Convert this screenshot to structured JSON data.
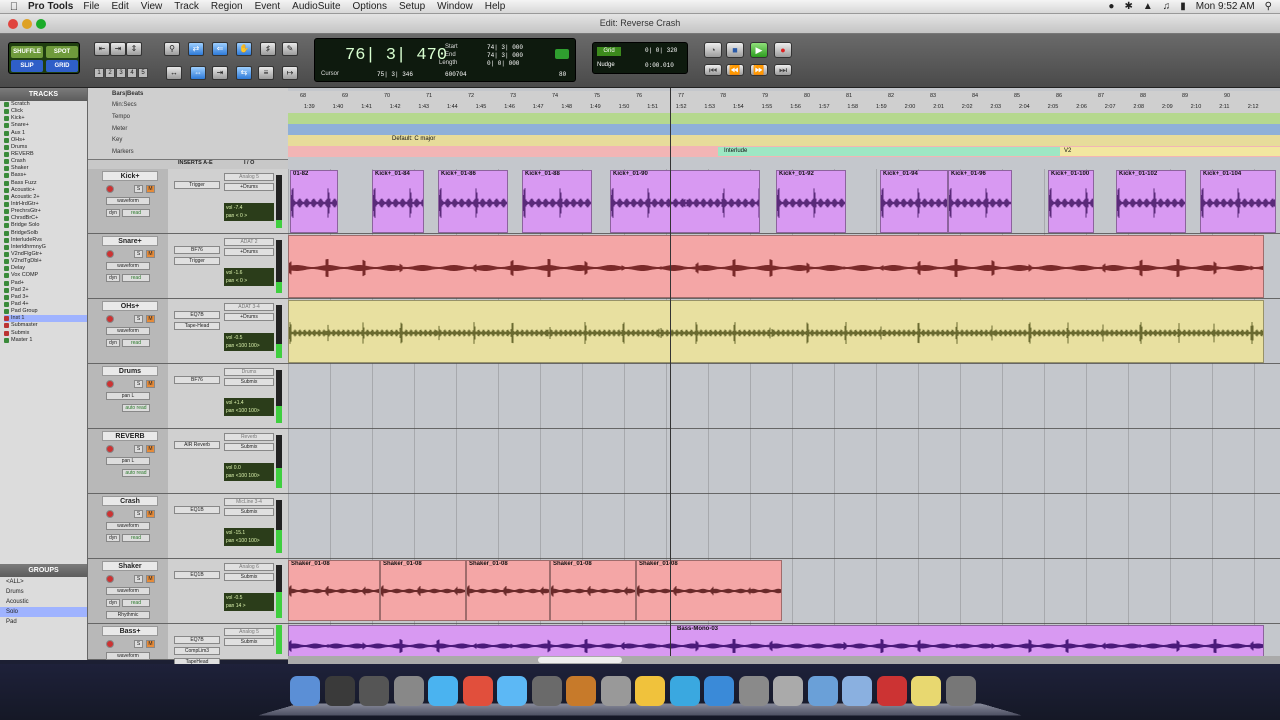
{
  "menubar": {
    "app": "Pro Tools",
    "items": [
      "File",
      "Edit",
      "View",
      "Track",
      "Region",
      "Event",
      "AudioSuite",
      "Options",
      "Setup",
      "Window",
      "Help"
    ],
    "clock": "Mon 9:52 AM"
  },
  "window": {
    "title": "Edit: Reverse Crash"
  },
  "toolbar": {
    "modes": [
      "SHUFFLE",
      "SPOT",
      "SLIP",
      "GRID"
    ],
    "zoom_presets": [
      "1",
      "2",
      "3",
      "4",
      "5"
    ],
    "main_counter": "76| 3| 470",
    "start_label": "Start",
    "end_label": "End",
    "length_label": "Length",
    "start": "74| 3| 000",
    "end": "74| 3| 000",
    "length": "0| 0| 000",
    "cursor_label": "Cursor",
    "cursor": "75| 3| 346",
    "sample": "600704",
    "tempo": "80",
    "grid_label": "Grid",
    "grid_value": "0| 0| 320",
    "nudge_label": "Nudge",
    "nudge_value": "0:00.010"
  },
  "tracks_panel": {
    "title": "TRACKS",
    "items": [
      "Scratch",
      "Click",
      "Kick+",
      "Snare+",
      "Aux 1",
      "OHs+",
      "Drums",
      "REVERB",
      "Crash",
      "Shaker",
      "Bass+",
      "Bass Fuzz",
      "Acoustic+",
      "Acoustic 2+",
      "IntrHrdGtr+",
      "PrechrsGtr+",
      "ChrsdBrC+",
      "Bridge Solo",
      "BridgeSolb",
      "InterludeRvs",
      "InterldhrmnyG",
      "V2ndFlgGtr+",
      "V2ndTgDbl+",
      "Delay",
      "Vox COMP",
      "Pad+",
      "Pad 2+",
      "Pad 3+",
      "Pad 4+",
      "Pad Group",
      "Inst 1",
      "Submaster",
      "Submix",
      "Master 1"
    ]
  },
  "groups_panel": {
    "title": "GROUPS",
    "items": [
      "<ALL>",
      "Drums",
      "Acoustic",
      "Solo",
      "Pad"
    ]
  },
  "ruler": {
    "labels": [
      "Bars|Beats",
      "Min:Secs",
      "Tempo",
      "Meter",
      "Key",
      "Markers"
    ],
    "bars": [
      "68",
      "69",
      "70",
      "71",
      "72",
      "73",
      "74",
      "75",
      "76",
      "77",
      "78",
      "79",
      "80",
      "81",
      "82",
      "83",
      "84",
      "85",
      "86",
      "87",
      "88",
      "89",
      "90"
    ],
    "times": [
      "1:39",
      "1:40",
      "1:41",
      "1:42",
      "1:43",
      "1:44",
      "1:45",
      "1:46",
      "1:47",
      "1:48",
      "1:49",
      "1:50",
      "1:51",
      "1:52",
      "1:53",
      "1:54",
      "1:55",
      "1:56",
      "1:57",
      "1:58",
      "1:59",
      "2:00",
      "2:01",
      "2:02",
      "2:03",
      "2:04",
      "2:05",
      "2:06",
      "2:07",
      "2:08",
      "2:09",
      "2:10",
      "2:11",
      "2:12"
    ],
    "key_text": "Default: C major",
    "marker_interlude": "Interlude",
    "marker_v2": "V2"
  },
  "header_cols": {
    "inserts": "INSERTS A-E",
    "io": "I / O"
  },
  "tracks": [
    {
      "name": "Kick+",
      "insert1": "Trigger",
      "io_in": "Analog 5",
      "io_out": "+Drums",
      "view": "waveform",
      "dyn": "dyn",
      "mode": "read",
      "vol": "-7.4",
      "pan": "< 0 >",
      "color": "#d899f2"
    },
    {
      "name": "Snare+",
      "insert1": "BF76",
      "insert2": "Trigger",
      "io_in": "ADAT 2",
      "io_out": "+Drums",
      "view": "waveform",
      "dyn": "dyn",
      "mode": "read",
      "vol": "-1.6",
      "pan": "< 0 >",
      "color": "#f4a6a6"
    },
    {
      "name": "OHs+",
      "insert1": "EQ7B",
      "insert2": "Tape-Head",
      "io_in": "ADAT 3-4",
      "io_out": "+Drums",
      "view": "waveform",
      "dyn": "dyn",
      "mode": "read",
      "vol": "-0.5",
      "pan": "<100  100>",
      "color": "#e8e0a0"
    },
    {
      "name": "Drums",
      "insert1": "BF76",
      "io_in": "Drums",
      "io_out": "Submix",
      "view": "pan L",
      "mode": "auto read",
      "vol": "+1.4",
      "pan": "<100  100>"
    },
    {
      "name": "REVERB",
      "insert1": "AIR Reverb",
      "io_in": "Reverb",
      "io_out": "Submix",
      "view": "pan L",
      "mode": "auto read",
      "vol": "0.0",
      "pan": "<100  100>"
    },
    {
      "name": "Crash",
      "insert1": "EQ1B",
      "io_in": "MicLine 3-4",
      "io_out": "Submix",
      "view": "waveform",
      "dyn": "dyn",
      "mode": "read",
      "vol": "-15.1",
      "pan": "<100  100>"
    },
    {
      "name": "Shaker",
      "insert1": "EQ1B",
      "io_in": "Analog 6",
      "io_out": "Submix",
      "view": "waveform",
      "dyn": "dyn",
      "mode": "read",
      "vol": "-0.5",
      "pan": "14 >",
      "group": "Rhythmic"
    },
    {
      "name": "Bass+",
      "insert1": "EQ7B",
      "insert2": "CompLim3",
      "insert3": "TapeHead",
      "io_in": "Analog 5",
      "io_out": "Submix",
      "view": "waveform"
    }
  ],
  "regions": {
    "kick": [
      "01-82",
      "Kick+_01-84",
      "Kick+_01-86",
      "Kick+_01-88",
      "Kick+_01-90",
      "Kick+_01-92",
      "Kick+_01-94",
      "Kick+_01-96",
      "Kick+_01-100",
      "Kick+_01-102",
      "Kick+_01-104"
    ],
    "shaker": [
      "Shaker_01-08",
      "Shaker_01-08",
      "Shaker_01-08",
      "Shaker_01-08",
      "Shaker_01-08"
    ],
    "bass": [
      "Bass-Mono-03"
    ]
  },
  "dock": {
    "items": [
      "Finder",
      "Pro Tools",
      "MIX",
      "App",
      "Wave",
      "Chrome",
      "iTunes",
      "Star",
      "GarageBand",
      "Preview",
      "Adium",
      "Skype",
      "Safari",
      "System",
      "Calc",
      "Folder",
      "Folder",
      "PDF",
      "Notes",
      "Trash"
    ]
  },
  "colors": {
    "accent": "#2e7ad8",
    "counter_green": "#0e1a0e",
    "kick": "#d899f2",
    "snare": "#f4a6a6",
    "ohs": "#e8e0a0",
    "shaker": "#f4a6a6",
    "bass": "#d899f2",
    "marker_bar": "#9ee7c4"
  }
}
